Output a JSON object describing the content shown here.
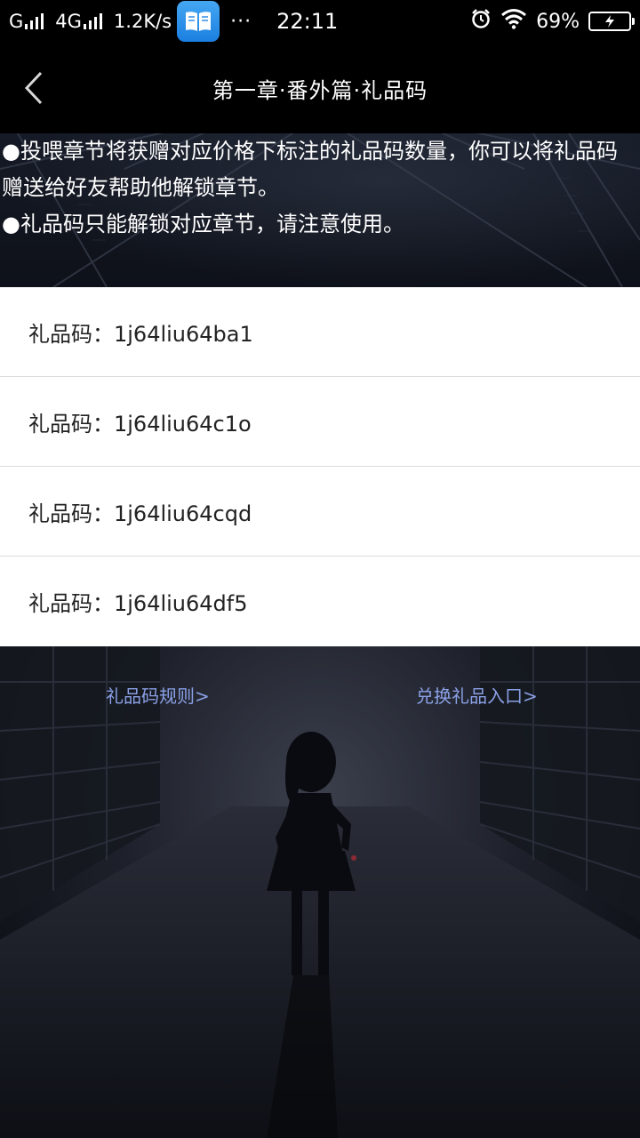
{
  "status_bar": {
    "network_1": "G",
    "network_2": "4G",
    "speed": "1.2K/s",
    "app_icon": "book-icon",
    "dots": "···",
    "time": "22:11",
    "battery": "69%",
    "icons": [
      "alarm-icon",
      "wifi-icon",
      "battery-icon"
    ]
  },
  "nav": {
    "back_icon": "chevron-left-icon",
    "title": "第一章·番外篇·礼品码"
  },
  "notice": {
    "line_1": "●投喂章节将获赠对应价格下标注的礼品码数量，你可以将礼品码赠送给好友帮助他解锁章节。",
    "line_2": "●礼品码只能解锁对应章节，请注意使用。"
  },
  "gift_codes": [
    "礼品码：1j64liu64ba1",
    "礼品码：1j64liu64c1o",
    "礼品码：1j64liu64cqd",
    "礼品码：1j64liu64df5"
  ],
  "links": {
    "rules": "礼品码规则>",
    "redeem": "兑换礼品入口>"
  },
  "colors": {
    "link": "#8aa0e6",
    "bar": "#000000",
    "list_bg": "#ffffff"
  }
}
